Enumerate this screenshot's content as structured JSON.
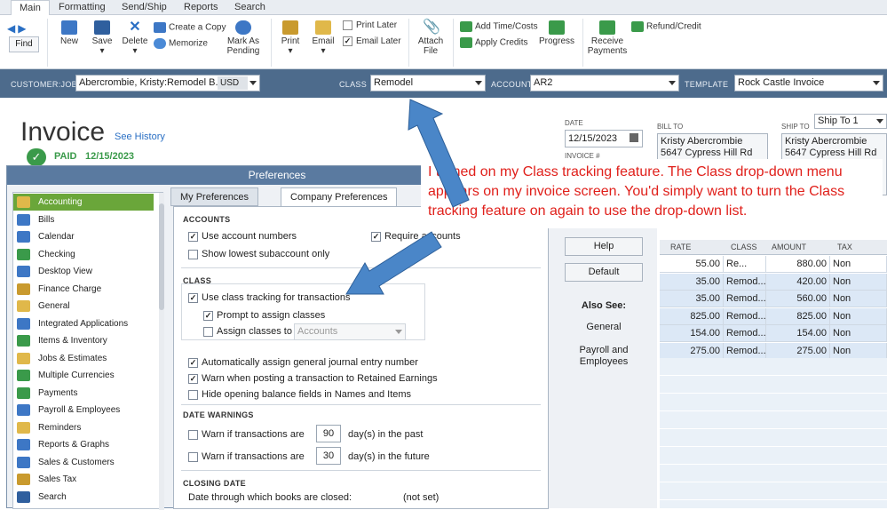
{
  "ribbon": {
    "tabs": [
      "Main",
      "Formatting",
      "Send/Ship",
      "Reports",
      "Search"
    ],
    "find": "Find",
    "new": "New",
    "save": "Save",
    "delete": "Delete",
    "create_copy": "Create a Copy",
    "memorize": "Memorize",
    "mark_pending_1": "Mark As",
    "mark_pending_2": "Pending",
    "print": "Print",
    "email": "Email",
    "print_later": "Print Later",
    "email_later": "Email Later",
    "attach_1": "Attach",
    "attach_2": "File",
    "add_time": "Add Time/Costs",
    "apply_credits": "Apply Credits",
    "progress": "Progress",
    "receive_1": "Receive",
    "receive_2": "Payments",
    "refund": "Refund/Credit"
  },
  "header": {
    "customer_label": "CUSTOMER:JOB",
    "customer_value": "Abercrombie, Kristy:Remodel B...",
    "currency": "USD",
    "class_label": "CLASS",
    "class_value": "Remodel",
    "account_label": "ACCOUNT",
    "account_value": "AR2",
    "template_label": "TEMPLATE",
    "template_value": "Rock Castle Invoice"
  },
  "invoice": {
    "title": "Invoice",
    "see_history": "See History",
    "paid_label": "PAID",
    "paid_date": "12/15/2023",
    "date_label": "DATE",
    "date_value": "12/15/2023",
    "invoice_num_label": "INVOICE #",
    "bill_to_label": "BILL TO",
    "bill_to_name": "Kristy Abercrombie",
    "bill_to_addr": "5647 Cypress Hill Rd",
    "ship_to_label": "SHIP TO",
    "ship_to_value": "Ship To 1",
    "ship_to_name": "Kristy Abercrombie",
    "ship_to_addr": "5647 Cypress Hill Rd"
  },
  "grid": {
    "headers": [
      "RATE",
      "CLASS",
      "AMOUNT",
      "TAX"
    ],
    "rows": [
      {
        "rate": "55.00",
        "class": "Re...",
        "amount": "880.00",
        "tax": "Non"
      },
      {
        "rate": "35.00",
        "class": "Remod...",
        "amount": "420.00",
        "tax": "Non"
      },
      {
        "rate": "35.00",
        "class": "Remod...",
        "amount": "560.00",
        "tax": "Non"
      },
      {
        "rate": "825.00",
        "class": "Remod...",
        "amount": "825.00",
        "tax": "Non"
      },
      {
        "rate": "154.00",
        "class": "Remod...",
        "amount": "154.00",
        "tax": "Non"
      },
      {
        "rate": "275.00",
        "class": "Remod...",
        "amount": "275.00",
        "tax": "Non"
      }
    ]
  },
  "prefs": {
    "title": "Preferences",
    "tab_my": "My Preferences",
    "tab_company": "Company Preferences",
    "list": [
      "Accounting",
      "Bills",
      "Calendar",
      "Checking",
      "Desktop View",
      "Finance Charge",
      "General",
      "Integrated Applications",
      "Items & Inventory",
      "Jobs & Estimates",
      "Multiple Currencies",
      "Payments",
      "Payroll & Employees",
      "Reminders",
      "Reports & Graphs",
      "Sales & Customers",
      "Sales Tax",
      "Search"
    ],
    "accounts_hd": "ACCOUNTS",
    "use_account_numbers": "Use account numbers",
    "require_accounts": "Require accounts",
    "show_lowest": "Show lowest subaccount only",
    "class_hd": "CLASS",
    "use_class": "Use class tracking for transactions",
    "prompt_assign": "Prompt to assign classes",
    "assign_to": "Assign classes to",
    "assign_to_value": "Accounts",
    "auto_assign": "Automatically assign general journal entry number",
    "warn_retained": "Warn when posting a transaction to Retained Earnings",
    "hide_opening": "Hide opening balance fields in Names and Items",
    "date_warn_hd": "DATE WARNINGS",
    "warn_past": "Warn if transactions are",
    "past_days": "90",
    "past_suffix": "day(s) in the past",
    "warn_future": "Warn if transactions are",
    "future_days": "30",
    "future_suffix": "day(s) in the future",
    "closing_hd": "CLOSING DATE",
    "closing_text": "Date through which books are closed:",
    "closing_value": "(not set)",
    "help": "Help",
    "default": "Default",
    "also_see": "Also See:",
    "also_general": "General",
    "also_payroll_1": "Payroll and",
    "also_payroll_2": "Employees"
  },
  "annotation": {
    "text": "I turned on my Class tracking feature. The Class drop-down menu appears on my invoice screen. You'd simply want to turn the Class tracking feature on again to use the drop-down list."
  },
  "colors": {
    "accent": "#4d6b8c",
    "selected": "#6aa63a",
    "arrow": "#4a86c8",
    "annotation": "#e0201b"
  }
}
